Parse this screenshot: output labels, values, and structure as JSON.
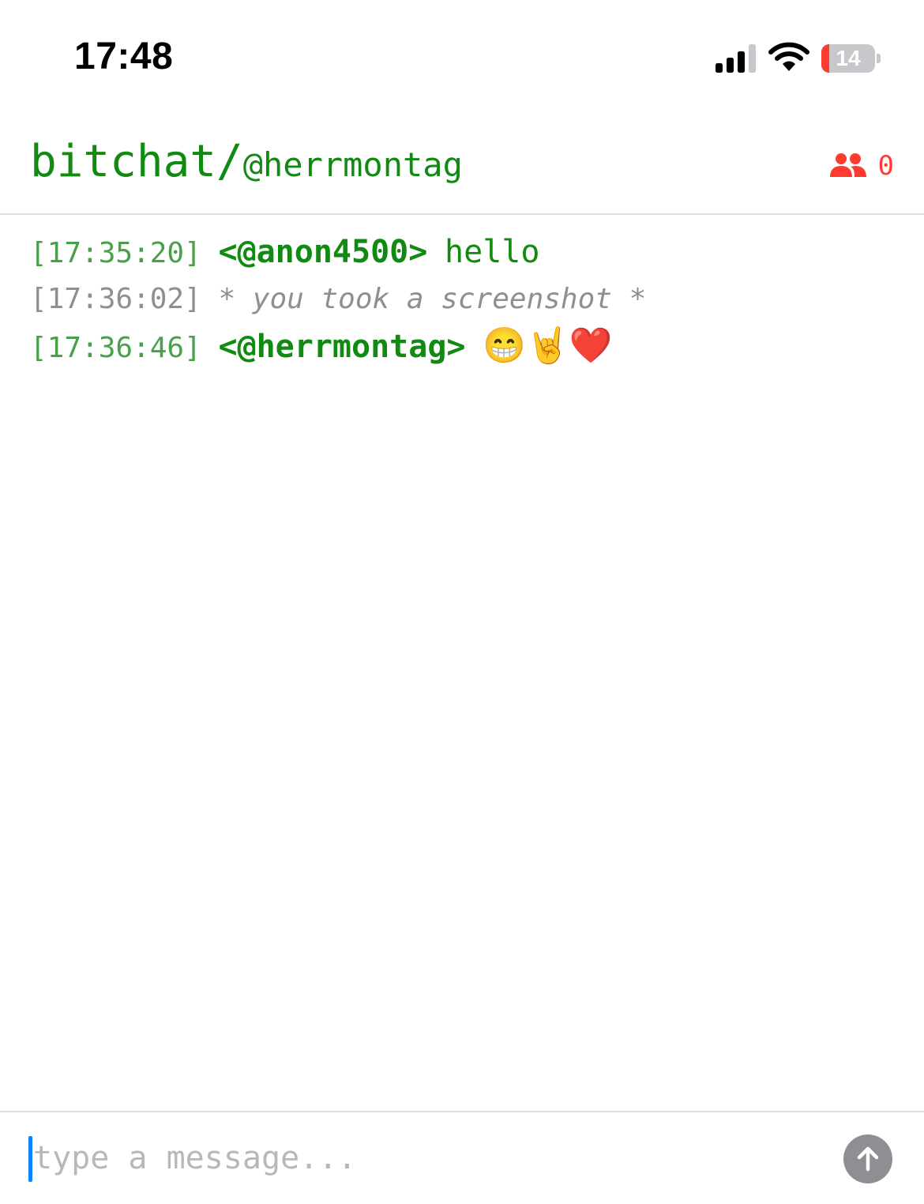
{
  "status_bar": {
    "time": "17:48",
    "battery_level": "14",
    "battery_fraction": 0.14,
    "icons": [
      "signal-icon",
      "wifi-icon",
      "battery-icon"
    ]
  },
  "header": {
    "app_name": "bitchat/",
    "nickname": "@herrmontag",
    "peer_count": "0",
    "peer_icon": "people-icon"
  },
  "messages": [
    {
      "timestamp": "[17:35:20]",
      "sender": "<@anon4500>",
      "text": "hello"
    },
    {
      "timestamp": "[17:36:02]",
      "system": "* you took a screenshot *"
    },
    {
      "timestamp": "[17:36:46]",
      "sender": "<@herrmontag>",
      "text": "😁🤘❤️"
    }
  ],
  "composer": {
    "placeholder": "type a message...",
    "value": "",
    "send_icon": "arrow-up-icon"
  },
  "colors": {
    "accent_green": "#118a11",
    "timestamp_green": "#4aa04a",
    "alert_red": "#ff3b30",
    "system_gray": "#8e8e93",
    "caret_blue": "#0a84ff"
  }
}
